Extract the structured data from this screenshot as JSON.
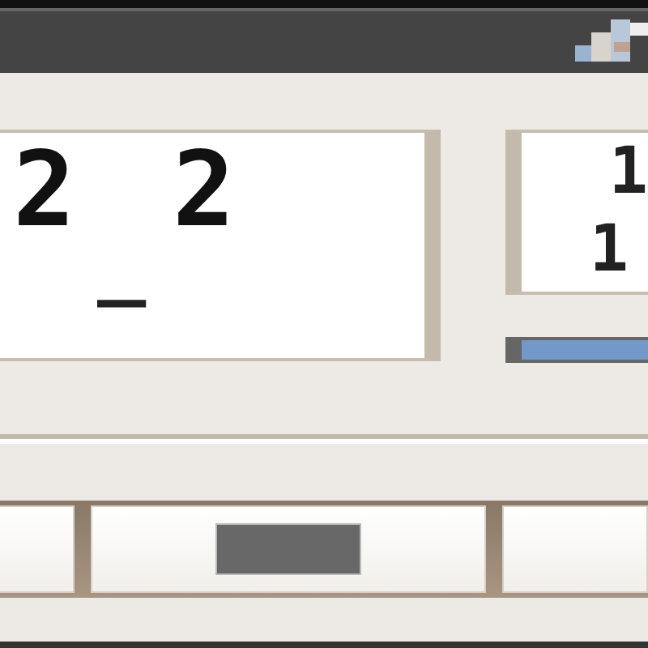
{
  "display": {
    "digits": [
      "2",
      "2"
    ],
    "cursor": "_"
  },
  "side_display": {
    "lines": [
      "1",
      "1"
    ]
  },
  "buttons": [
    {
      "kind": "blank"
    },
    {
      "kind": "glyph"
    },
    {
      "kind": "blank"
    }
  ]
}
